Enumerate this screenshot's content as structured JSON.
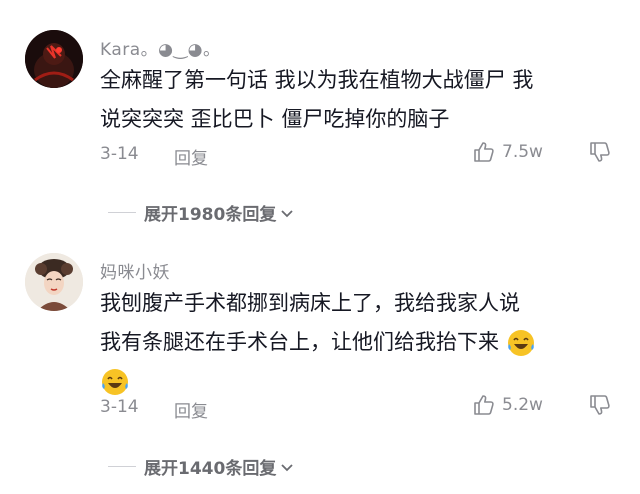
{
  "comments": [
    {
      "username": "Kara。◕‿◕。",
      "lines": [
        "全麻醒了第一句话 我以为我在植物大战僵尸 我",
        "说突突突 歪比巴卜 僵尸吃掉你的脑子"
      ],
      "date": "3-14",
      "reply_label": "回复",
      "likes": "7.5w",
      "avatar_icon": "dark-portrait-avatar",
      "expand_label": "展开1980条回复"
    },
    {
      "username": "妈咪小妖",
      "lines": [
        "我刨腹产手术都挪到病床上了，我给我家人说",
        "我有条腿还在手术台上，让他们给我抬下来"
      ],
      "date": "3-14",
      "reply_label": "回复",
      "likes": "5.2w",
      "avatar_icon": "traditional-lady-avatar",
      "emoji": "tears-of-joy-emoji",
      "expand_label": "展开1440条回复"
    }
  ],
  "colors": {
    "text": "#161823",
    "meta": "#8a8b91",
    "accent_emoji": "#f5c518"
  }
}
